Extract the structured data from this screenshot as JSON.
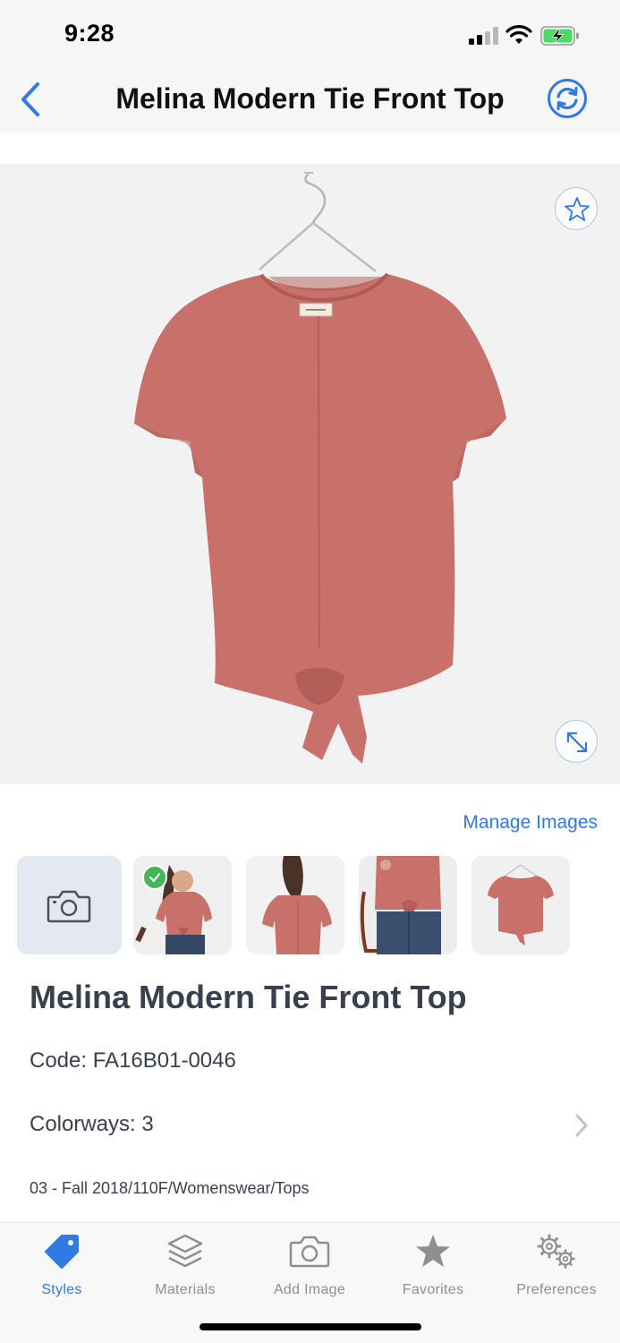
{
  "status_bar": {
    "time": "9:28",
    "icons": [
      "cellular-signal-icon",
      "wifi-icon",
      "battery-charging-icon"
    ]
  },
  "nav": {
    "title": "Melina Modern Tie Front Top",
    "back_icon": "chevron-left-icon",
    "sync_icon": "sync-icon"
  },
  "hero": {
    "image_subject": "coral short-sleeve tie-front t-shirt on hanger",
    "favorite_icon": "star-outline-icon",
    "expand_icon": "expand-arrows-icon"
  },
  "manage_images_label": "Manage Images",
  "thumbnails": [
    {
      "type": "camera",
      "icon": "camera-icon"
    },
    {
      "type": "image",
      "subject": "model wearing top front view",
      "selected": true
    },
    {
      "type": "image",
      "subject": "model wearing top back view",
      "selected": false
    },
    {
      "type": "image",
      "subject": "model wearing top with jeans and bag",
      "selected": false
    },
    {
      "type": "image",
      "subject": "top on hanger",
      "selected": false
    }
  ],
  "product": {
    "title": "Melina Modern Tie Front Top",
    "code": "Code: FA16B01-0046",
    "colorways": "Colorways: 3",
    "path": "03 - Fall 2018/110F/Womenswear/Tops"
  },
  "tabs": [
    {
      "label": "Styles",
      "icon": "tag-icon",
      "active": true
    },
    {
      "label": "Materials",
      "icon": "layers-icon",
      "active": false
    },
    {
      "label": "Add Image",
      "icon": "camera-icon",
      "active": false
    },
    {
      "label": "Favorites",
      "icon": "star-icon",
      "active": false
    },
    {
      "label": "Preferences",
      "icon": "gears-icon",
      "active": false
    }
  ],
  "colors": {
    "accent": "#2f7ae5",
    "text_dark": "#3a3f50",
    "tab_inactive": "#8e8e93",
    "shirt": "#c8716a",
    "check_green": "#43b65a"
  }
}
